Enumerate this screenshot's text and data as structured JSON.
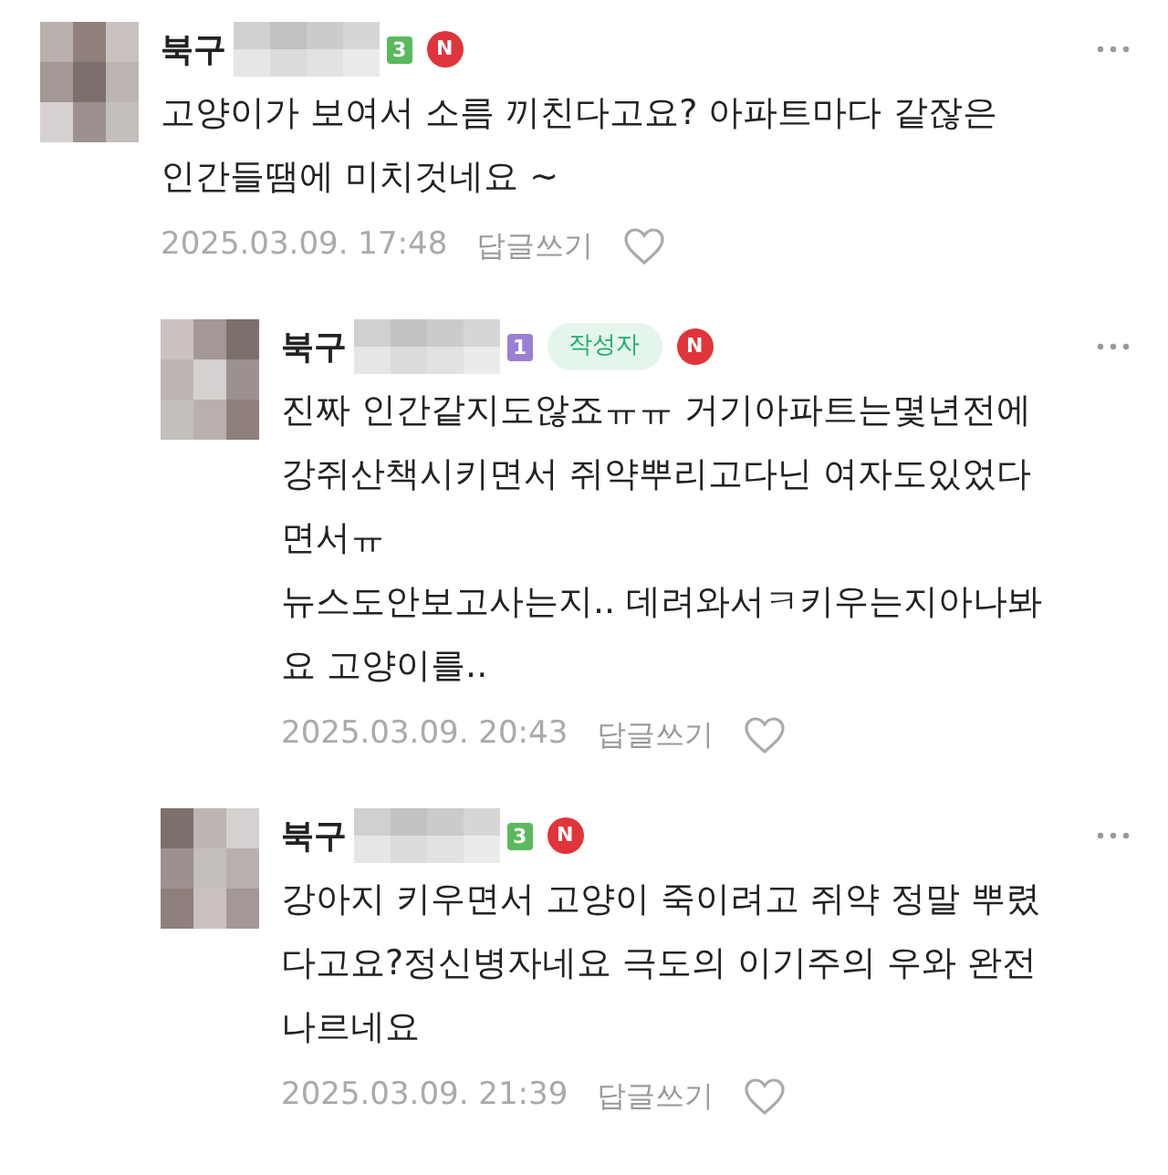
{
  "comments": [
    {
      "nickname": "북구",
      "level_badge": {
        "text": "3",
        "color": "#5cb85c"
      },
      "author": false,
      "new_badge": "N",
      "body": "고양이가 보여서 소름 끼친다고요? 아파트마다 같잖은\n인간들땜에 미치것네요 ~",
      "date": "2025.03.09. 17:48",
      "reply_link": "답글쓰기",
      "replies": [
        {
          "nickname": "북구",
          "level_badge": {
            "text": "1",
            "color": "#9b7fd4"
          },
          "author": true,
          "author_label": "작성자",
          "new_badge": "N",
          "body": "진짜 인간같지도않죠ㅠㅠ 거기아파트는몇년전에\n강쥐산책시키면서 쥐약뿌리고다닌 여자도있었다\n면서ㅠ\n뉴스도안보고사는지.. 데려와서ㅋ키우는지아나봐\n요 고양이를..",
          "date": "2025.03.09. 20:43",
          "reply_link": "답글쓰기"
        },
        {
          "nickname": "북구",
          "level_badge": {
            "text": "3",
            "color": "#5cb85c"
          },
          "author": false,
          "new_badge": "N",
          "body": "강아지 키우면서 고양이 죽이려고 쥐약 정말 뿌렸\n다고요?정신병자네요 극도의 이기주의 우와 완전\n나르네요",
          "date": "2025.03.09. 21:39",
          "reply_link": "답글쓰기"
        }
      ]
    }
  ]
}
